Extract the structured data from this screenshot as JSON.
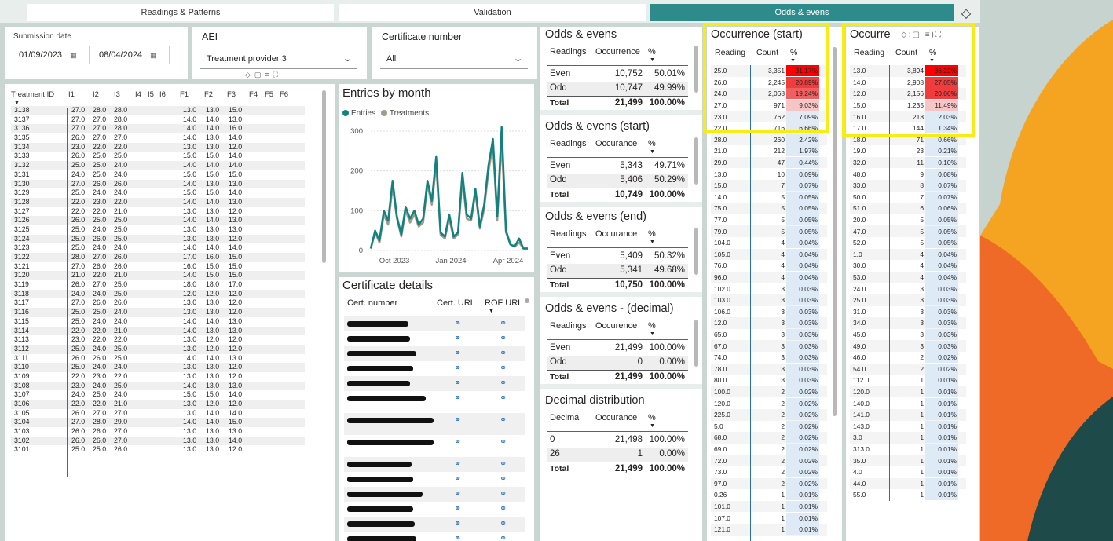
{
  "tabs": [
    {
      "label": "Readings & Patterns"
    },
    {
      "label": "Validation"
    },
    {
      "label": "Odds & evens"
    }
  ],
  "filters": {
    "submission_label": "Submission date",
    "date_from": "01/09/2023",
    "date_to": "08/04/2024",
    "aei_label": "AEI",
    "aei_value": "Treatment provider 3",
    "cert_label": "Certificate number",
    "cert_value": "All"
  },
  "treatment_table": {
    "headers": [
      "Treatment ID",
      "I1",
      "I2",
      "I3",
      "I4",
      "I5",
      "I6",
      "F1",
      "F2",
      "F3",
      "F4",
      "F5",
      "F6"
    ],
    "rows": [
      [
        "3138",
        "27.0",
        "28.0",
        "28.0",
        "13.0",
        "13.0",
        "15.0"
      ],
      [
        "3137",
        "27.0",
        "27.0",
        "28.0",
        "14.0",
        "14.0",
        "13.0"
      ],
      [
        "3136",
        "27.0",
        "27.0",
        "28.0",
        "14.0",
        "14.0",
        "16.0"
      ],
      [
        "3135",
        "26.0",
        "27.0",
        "27.0",
        "14.0",
        "13.0",
        "14.0"
      ],
      [
        "3134",
        "23.0",
        "22.0",
        "22.0",
        "13.0",
        "13.0",
        "12.0"
      ],
      [
        "3133",
        "26.0",
        "25.0",
        "25.0",
        "15.0",
        "15.0",
        "14.0"
      ],
      [
        "3132",
        "25.0",
        "25.0",
        "24.0",
        "14.0",
        "14.0",
        "14.0"
      ],
      [
        "3131",
        "24.0",
        "25.0",
        "24.0",
        "15.0",
        "15.0",
        "15.0"
      ],
      [
        "3130",
        "27.0",
        "26.0",
        "26.0",
        "14.0",
        "13.0",
        "13.0"
      ],
      [
        "3129",
        "25.0",
        "24.0",
        "24.0",
        "15.0",
        "15.0",
        "14.0"
      ],
      [
        "3128",
        "22.0",
        "23.0",
        "22.0",
        "14.0",
        "14.0",
        "13.0"
      ],
      [
        "3127",
        "22.0",
        "22.0",
        "21.0",
        "13.0",
        "13.0",
        "12.0"
      ],
      [
        "3126",
        "26.0",
        "25.0",
        "25.0",
        "14.0",
        "14.0",
        "13.0"
      ],
      [
        "3125",
        "25.0",
        "24.0",
        "25.0",
        "13.0",
        "13.0",
        "13.0"
      ],
      [
        "3124",
        "25.0",
        "26.0",
        "25.0",
        "13.0",
        "13.0",
        "12.0"
      ],
      [
        "3123",
        "25.0",
        "24.0",
        "24.0",
        "14.0",
        "14.0",
        "14.0"
      ],
      [
        "3122",
        "28.0",
        "27.0",
        "26.0",
        "17.0",
        "16.0",
        "15.0"
      ],
      [
        "3121",
        "27.0",
        "26.0",
        "26.0",
        "16.0",
        "15.0",
        "15.0"
      ],
      [
        "3120",
        "21.0",
        "22.0",
        "21.0",
        "14.0",
        "15.0",
        "15.0"
      ],
      [
        "3119",
        "26.0",
        "27.0",
        "25.0",
        "18.0",
        "18.0",
        "17.0"
      ],
      [
        "3118",
        "24.0",
        "24.0",
        "25.0",
        "12.0",
        "12.0",
        "12.0"
      ],
      [
        "3117",
        "27.0",
        "26.0",
        "26.0",
        "13.0",
        "13.0",
        "12.0"
      ],
      [
        "3116",
        "25.0",
        "25.0",
        "24.0",
        "13.0",
        "13.0",
        "12.0"
      ],
      [
        "3115",
        "25.0",
        "24.0",
        "24.0",
        "14.0",
        "14.0",
        "13.0"
      ],
      [
        "3114",
        "22.0",
        "22.0",
        "21.0",
        "14.0",
        "13.0",
        "13.0"
      ],
      [
        "3113",
        "23.0",
        "22.0",
        "22.0",
        "13.0",
        "12.0",
        "12.0"
      ],
      [
        "3112",
        "25.0",
        "24.0",
        "25.0",
        "13.0",
        "12.0",
        "12.0"
      ],
      [
        "3111",
        "26.0",
        "26.0",
        "25.0",
        "14.0",
        "14.0",
        "13.0"
      ],
      [
        "3110",
        "25.0",
        "24.0",
        "24.0",
        "13.0",
        "13.0",
        "12.0"
      ],
      [
        "3109",
        "22.0",
        "23.0",
        "22.0",
        "13.0",
        "13.0",
        "12.0"
      ],
      [
        "3108",
        "23.0",
        "24.0",
        "25.0",
        "14.0",
        "13.0",
        "13.0"
      ],
      [
        "3107",
        "24.0",
        "25.0",
        "24.0",
        "15.0",
        "15.0",
        "14.0"
      ],
      [
        "3106",
        "22.0",
        "22.0",
        "21.0",
        "13.0",
        "12.0",
        "12.0"
      ],
      [
        "3105",
        "26.0",
        "27.0",
        "27.0",
        "13.0",
        "14.0",
        "14.0"
      ],
      [
        "3104",
        "27.0",
        "28.0",
        "29.0",
        "14.0",
        "14.0",
        "15.0"
      ],
      [
        "3103",
        "26.0",
        "26.0",
        "27.0",
        "13.0",
        "13.0",
        "13.0"
      ],
      [
        "3102",
        "26.0",
        "26.0",
        "27.0",
        "13.0",
        "13.0",
        "14.0"
      ],
      [
        "3101",
        "25.0",
        "25.0",
        "26.0",
        "13.0",
        "13.0",
        "12.0"
      ]
    ]
  },
  "entries_chart": {
    "title": "Entries by month",
    "legend": [
      "Entries",
      "Treatments"
    ],
    "y_ticks": [
      "300",
      "200",
      "100",
      "0"
    ],
    "x_ticks": [
      "Oct 2023",
      "Jan 2024",
      "Apr 2024"
    ],
    "colors": {
      "entries": "#13827f",
      "treatments": "#a39a8c"
    }
  },
  "chart_data": {
    "type": "line",
    "title": "Entries by month",
    "ylim": [
      0,
      300
    ],
    "series": [
      {
        "name": "Entries",
        "values": [
          5,
          50,
          25,
          100,
          75,
          175,
          85,
          40,
          110,
          80,
          100,
          65,
          80,
          175,
          125,
          235,
          45,
          35,
          90,
          35,
          45,
          195,
          90,
          80,
          155,
          60,
          115,
          215,
          280,
          85,
          310,
          50,
          15,
          10,
          30,
          5,
          5
        ]
      },
      {
        "name": "Treatments",
        "values": [
          5,
          45,
          20,
          90,
          65,
          160,
          80,
          35,
          100,
          70,
          90,
          60,
          70,
          165,
          115,
          215,
          40,
          30,
          80,
          30,
          40,
          180,
          80,
          75,
          145,
          55,
          105,
          200,
          265,
          75,
          275,
          45,
          15,
          10,
          20,
          5,
          5
        ]
      }
    ]
  },
  "cert": {
    "title": "Certificate details",
    "headers": [
      "Cert. number",
      "Cert. URL",
      "ROF URL"
    ],
    "rows": 14
  },
  "oe1": {
    "title": "Odds & evens",
    "headers": [
      "Readings",
      "Occurrence",
      "%"
    ],
    "rows": [
      [
        "Even",
        "10,752",
        "50.01%"
      ],
      [
        "Odd",
        "10,747",
        "49.99%"
      ],
      [
        "Total",
        "21,499",
        "100.00%"
      ]
    ]
  },
  "oe2": {
    "title": "Odds & evens (start)",
    "headers": [
      "Readings",
      "Occurance",
      "%"
    ],
    "rows": [
      [
        "Even",
        "5,343",
        "49.71%"
      ],
      [
        "Odd",
        "5,406",
        "50.29%"
      ],
      [
        "Total",
        "10,749",
        "100.00%"
      ]
    ]
  },
  "oe3": {
    "title": "Odds & evens (end)",
    "headers": [
      "Readings",
      "Occurance",
      "%"
    ],
    "rows": [
      [
        "Even",
        "5,409",
        "50.32%"
      ],
      [
        "Odd",
        "5,341",
        "49.68%"
      ],
      [
        "Total",
        "10,750",
        "100.00%"
      ]
    ]
  },
  "oe4": {
    "title": "Odds & evens - (decimal)",
    "headers": [
      "Readings",
      "Occurence",
      "%"
    ],
    "rows": [
      [
        "Even",
        "21,499",
        "100.00%"
      ],
      [
        "Odd",
        "0",
        "0.00%"
      ],
      [
        "Total",
        "21,499",
        "100.00%"
      ]
    ]
  },
  "dec": {
    "title": "Decimal distribution",
    "headers": [
      "Decimal",
      "Occurance",
      "%"
    ],
    "rows": [
      [
        "0",
        "21,498",
        "100.00%"
      ],
      [
        "26",
        "1",
        "0.00%"
      ],
      [
        "Total",
        "21,499",
        "100.00%"
      ]
    ]
  },
  "occ_start": {
    "title": "Occurrence (start)",
    "headers": [
      "Reading",
      "Count",
      "%"
    ],
    "rows": [
      [
        "25.0",
        "3,351",
        "31.17%"
      ],
      [
        "26.0",
        "2,245",
        "20.89%"
      ],
      [
        "24.0",
        "2,068",
        "19.24%"
      ],
      [
        "27.0",
        "971",
        "9.03%"
      ],
      [
        "23.0",
        "762",
        "7.09%"
      ],
      [
        "22.0",
        "716",
        "6.66%"
      ],
      [
        "28.0",
        "260",
        "2.42%"
      ],
      [
        "21.0",
        "212",
        "1.97%"
      ],
      [
        "29.0",
        "47",
        "0.44%"
      ],
      [
        "13.0",
        "10",
        "0.09%"
      ],
      [
        "15.0",
        "7",
        "0.07%"
      ],
      [
        "14.0",
        "5",
        "0.05%"
      ],
      [
        "75.0",
        "5",
        "0.05%"
      ],
      [
        "77.0",
        "5",
        "0.05%"
      ],
      [
        "79.0",
        "5",
        "0.05%"
      ],
      [
        "104.0",
        "4",
        "0.04%"
      ],
      [
        "105.0",
        "4",
        "0.04%"
      ],
      [
        "76.0",
        "4",
        "0.04%"
      ],
      [
        "96.0",
        "4",
        "0.04%"
      ],
      [
        "102.0",
        "3",
        "0.03%"
      ],
      [
        "103.0",
        "3",
        "0.03%"
      ],
      [
        "106.0",
        "3",
        "0.03%"
      ],
      [
        "12.0",
        "3",
        "0.03%"
      ],
      [
        "65.0",
        "3",
        "0.03%"
      ],
      [
        "67.0",
        "3",
        "0.03%"
      ],
      [
        "74.0",
        "3",
        "0.03%"
      ],
      [
        "78.0",
        "3",
        "0.03%"
      ],
      [
        "80.0",
        "3",
        "0.03%"
      ],
      [
        "100.0",
        "2",
        "0.02%"
      ],
      [
        "120.0",
        "2",
        "0.02%"
      ],
      [
        "225.0",
        "2",
        "0.02%"
      ],
      [
        "5.0",
        "2",
        "0.02%"
      ],
      [
        "68.0",
        "2",
        "0.02%"
      ],
      [
        "69.0",
        "2",
        "0.02%"
      ],
      [
        "72.0",
        "2",
        "0.02%"
      ],
      [
        "73.0",
        "2",
        "0.02%"
      ],
      [
        "97.0",
        "2",
        "0.02%"
      ],
      [
        "0.26",
        "1",
        "0.01%"
      ],
      [
        "101.0",
        "1",
        "0.01%"
      ],
      [
        "107.0",
        "1",
        "0.01%"
      ],
      [
        "121.0",
        "1",
        "0.01%"
      ]
    ]
  },
  "occ_end": {
    "title": "Occurre",
    "headers": [
      "Reading",
      "Count",
      "%"
    ],
    "rows": [
      [
        "13.0",
        "3,894",
        "36.22%"
      ],
      [
        "14.0",
        "2,908",
        "27.05%"
      ],
      [
        "12.0",
        "2,156",
        "20.06%"
      ],
      [
        "15.0",
        "1,235",
        "11.49%"
      ],
      [
        "16.0",
        "218",
        "2.03%"
      ],
      [
        "17.0",
        "144",
        "1.34%"
      ],
      [
        "18.0",
        "71",
        "0.66%"
      ],
      [
        "19.0",
        "23",
        "0.21%"
      ],
      [
        "32.0",
        "11",
        "0.10%"
      ],
      [
        "48.0",
        "9",
        "0.08%"
      ],
      [
        "33.0",
        "8",
        "0.07%"
      ],
      [
        "50.0",
        "7",
        "0.07%"
      ],
      [
        "51.0",
        "6",
        "0.06%"
      ],
      [
        "20.0",
        "5",
        "0.05%"
      ],
      [
        "47.0",
        "5",
        "0.05%"
      ],
      [
        "52.0",
        "5",
        "0.05%"
      ],
      [
        "1.0",
        "4",
        "0.04%"
      ],
      [
        "30.0",
        "4",
        "0.04%"
      ],
      [
        "53.0",
        "4",
        "0.04%"
      ],
      [
        "24.0",
        "3",
        "0.03%"
      ],
      [
        "25.0",
        "3",
        "0.03%"
      ],
      [
        "31.0",
        "3",
        "0.03%"
      ],
      [
        "34.0",
        "3",
        "0.03%"
      ],
      [
        "45.0",
        "3",
        "0.03%"
      ],
      [
        "49.0",
        "3",
        "0.03%"
      ],
      [
        "46.0",
        "2",
        "0.02%"
      ],
      [
        "54.0",
        "2",
        "0.02%"
      ],
      [
        "112.0",
        "1",
        "0.01%"
      ],
      [
        "120.0",
        "1",
        "0.01%"
      ],
      [
        "140.0",
        "1",
        "0.01%"
      ],
      [
        "141.0",
        "1",
        "0.01%"
      ],
      [
        "143.0",
        "1",
        "0.01%"
      ],
      [
        "3.0",
        "1",
        "0.01%"
      ],
      [
        "313.0",
        "1",
        "0.01%"
      ],
      [
        "35.0",
        "1",
        "0.01%"
      ],
      [
        "4.0",
        "1",
        "0.01%"
      ],
      [
        "44.0",
        "1",
        "0.01%"
      ],
      [
        "55.0",
        "1",
        "0.01%"
      ]
    ]
  }
}
